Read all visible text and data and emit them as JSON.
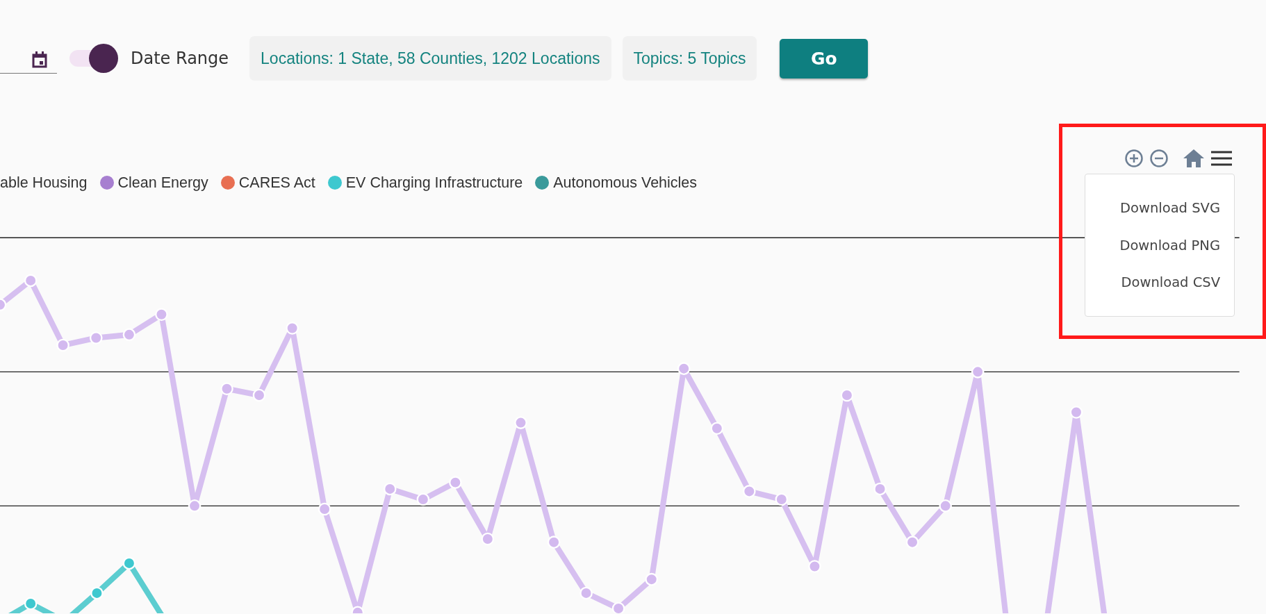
{
  "filters": {
    "date_range_toggle": {
      "on": true,
      "label": "Date Range"
    },
    "locations": "Locations: 1 State, 58 Counties, 1202 Locations",
    "topics": "Topics: 5 Topics",
    "go_button": "Go"
  },
  "legend": [
    {
      "label": "able Housing"
    },
    {
      "label": "Clean Energy",
      "color": "#a77fd0"
    },
    {
      "label": "CARES Act",
      "color": "#e86f52"
    },
    {
      "label": "EV Charging Infrastructure",
      "color": "#3ec8cf"
    },
    {
      "label": "Autonomous Vehicles",
      "color": "#3a9a9b"
    }
  ],
  "chart_toolbar": {
    "highlighted": true,
    "menu_expanded": true,
    "menu_items": [
      "Download SVG",
      "Download PNG",
      "Download CSV"
    ]
  }
}
